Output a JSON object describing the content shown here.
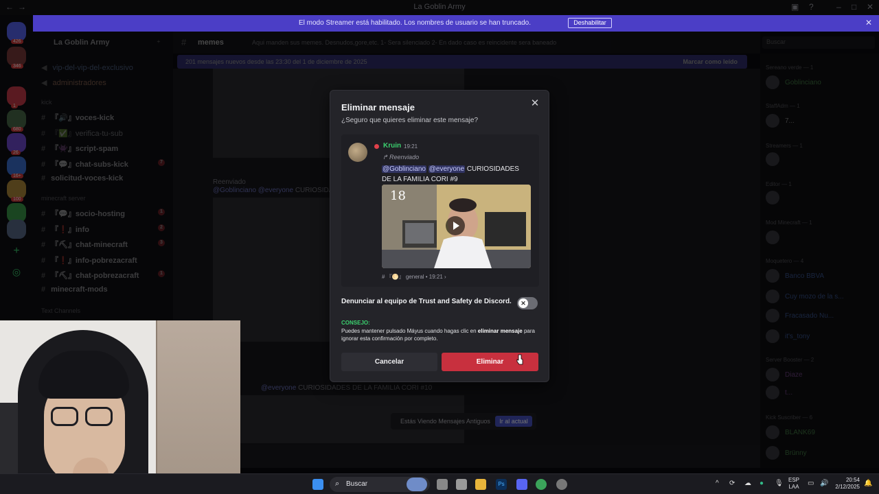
{
  "window": {
    "title": "La Goblin Army"
  },
  "banner": {
    "text": "El modo Streamer está habilitado. Los nombres de usuario se han truncado.",
    "button": "Deshabilitar"
  },
  "server": {
    "name": "La Goblin Army"
  },
  "rail_badges": [
    "426",
    "346",
    "1",
    "680",
    "26",
    "16+",
    "100"
  ],
  "sidebar": {
    "top_channels": [
      "vip-del-vip-del-exclusivo",
      "administradores"
    ],
    "categories": [
      "kick",
      "minecraft server",
      "Text Channels"
    ],
    "kick_channels": [
      {
        "label": "voces-kick",
        "count": ""
      },
      {
        "label": "verifica-tu-sub",
        "count": ""
      },
      {
        "label": "script-spam",
        "count": ""
      },
      {
        "label": "chat-subs-kick",
        "count": "7"
      },
      {
        "label": "solicitud-voces-kick",
        "count": ""
      }
    ],
    "mc_channels": [
      {
        "label": "socio-hosting",
        "count": "1"
      },
      {
        "label": "info",
        "count": "2"
      },
      {
        "label": "chat-minecraft",
        "count": "3"
      },
      {
        "label": "info-pobrezacraft",
        "count": ""
      },
      {
        "label": "chat-pobrezacraft",
        "count": "1"
      },
      {
        "label": "minecraft-mods",
        "count": ""
      }
    ]
  },
  "channel": {
    "name": "memes",
    "topic": "Aqui manden sus memes. Desnudos,gore,etc. 1- Sera silenciado 2- En dado caso es reincidente sera baneado"
  },
  "new_messages": {
    "text": "201 mensajes nuevos desde las 23:30 del 1 de diciembre de 2025",
    "action": "Marcar como leído"
  },
  "search": {
    "placeholder": "Buscar"
  },
  "bg_chat": {
    "forwarded": "Reenviado",
    "mention1": "@Goblinciano",
    "mention2": "@everyone",
    "curiosidades9": "CURIOSIDADES",
    "curiosidades10": "CURIOSIDADES DE LA FAMILIA CORI #10"
  },
  "members": {
    "categories": [
      "Sereano verde — 1",
      "StaffAdm — 1",
      "Streamers — 1",
      "Editor — 1",
      "Mod Minecraft — 1",
      "Moquetero — 4",
      "Server Booster — 2",
      "Kick Suscriber — 6"
    ],
    "names": [
      "Goblinciano",
      "7...",
      "Banco BBVA",
      "Cuy mozo de la s...",
      "Fracasado Nu...",
      "it's_tony",
      "Diaze",
      "t...",
      "BLANK69",
      "Brünny"
    ]
  },
  "modal": {
    "title": "Eliminar mensaje",
    "subtitle": "¿Seguro que quieres eliminar este mensaje?",
    "preview": {
      "author": "Kruin",
      "time": "19:21",
      "forwarded": "Reenviado",
      "mention1": "@Goblinciano",
      "mention2": "@everyone",
      "text": "CURIOSIDADES DE LA FAMILIA CORI #9",
      "video_number": "18",
      "origin": "# 『🌕』 general • 19:21 ›"
    },
    "report_label": "Denunciar al equipo de Trust and Safety de Discord.",
    "tip_label": "CONSEJO:",
    "tip_text_1": "Puedes mantener pulsado Máyus cuando hagas clic en ",
    "tip_bold": "eliminar mensaje",
    "tip_text_2": " para ignorar esta confirmación por completo.",
    "cancel": "Cancelar",
    "delete": "Eliminar"
  },
  "old_pill": {
    "text": "Estás Viendo Mensajes Antiguos",
    "button": "Ir al actual"
  },
  "taskbar": {
    "search": "Buscar",
    "lang1": "ESP",
    "lang2": "LAA",
    "time": "20:54",
    "date": "2/12/2025"
  },
  "colors": {
    "accent": "#5865f2",
    "danger": "#c8303e",
    "online": "#3bd16f"
  }
}
